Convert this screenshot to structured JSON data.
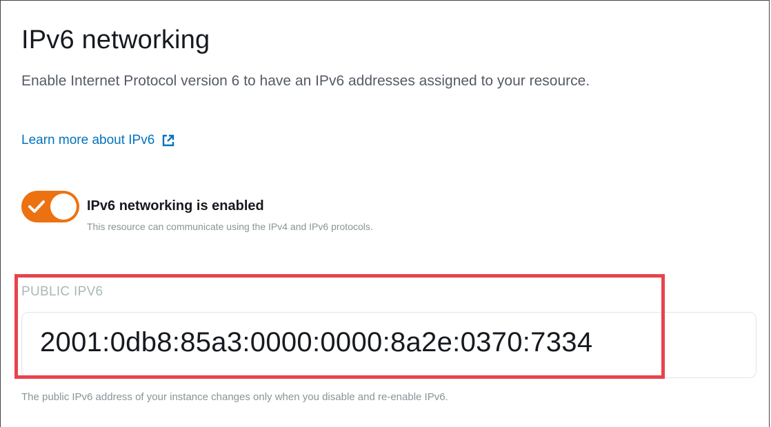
{
  "panel": {
    "title": "IPv6 networking",
    "description": "Enable Internet Protocol version 6 to have an IPv6 addresses assigned to your resource.",
    "learn_more_link": "Learn more about IPv6",
    "learn_more_icon": "external-link-icon"
  },
  "toggle": {
    "state": "on",
    "label": "IPv6 networking is enabled",
    "sublabel": "This resource can communicate using the IPv4 and IPv6 protocols.",
    "color": "#ec7211"
  },
  "public_ipv6": {
    "label": "PUBLIC IPV6",
    "value": "2001:0db8:85a3:0000:0000:8a2e:0370:7334",
    "footnote": "The public IPv6 address of your instance changes only when you disable and re-enable IPv6."
  },
  "colors": {
    "link": "#0073bb",
    "highlight_border": "#e8434c"
  }
}
